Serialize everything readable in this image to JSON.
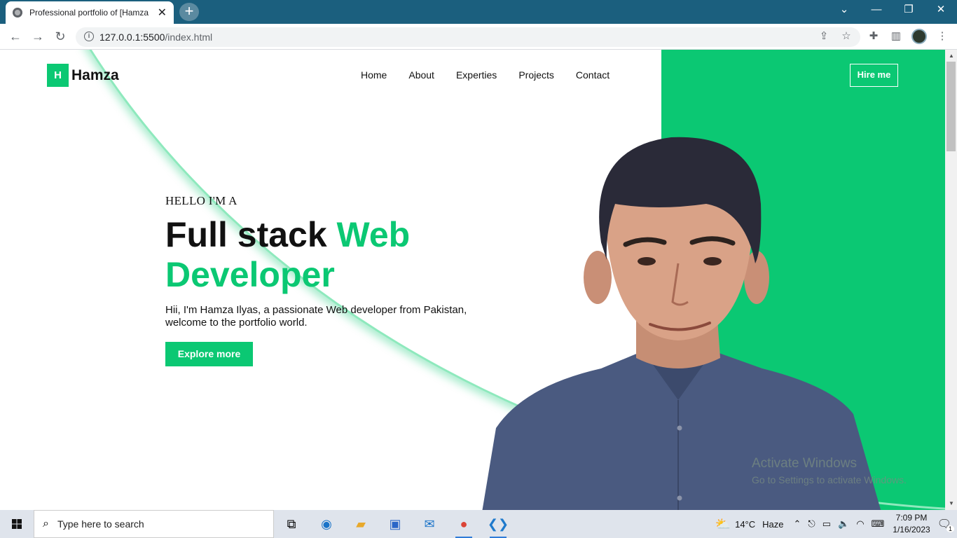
{
  "browser": {
    "tab_title": "Professional portfolio of [Hamza",
    "url_host": "127.0.0.1:5500",
    "url_path": "/index.html"
  },
  "site": {
    "logo_letter": "H",
    "logo_name": "Hamza",
    "nav": [
      "Home",
      "About",
      "Experties",
      "Projects",
      "Contact"
    ],
    "hire_label": "Hire me",
    "kicker": "HELLO I'M A",
    "title_dark": "Full stack ",
    "title_green_1": "Web",
    "title_green_2": "Developer",
    "description": "Hii, I'm Hamza Ilyas, a passionate Web developer from Pakistan, welcome to the portfolio world.",
    "cta": "Explore more",
    "accent_color": "#0bc873"
  },
  "watermark": {
    "line1": "Activate Windows",
    "line2": "Go to Settings to activate Windows."
  },
  "taskbar": {
    "search_placeholder": "Type here to search",
    "weather_temp": "14°C",
    "weather_desc": "Haze",
    "time": "7:09 PM",
    "date": "1/16/2023",
    "notification_count": "1"
  }
}
